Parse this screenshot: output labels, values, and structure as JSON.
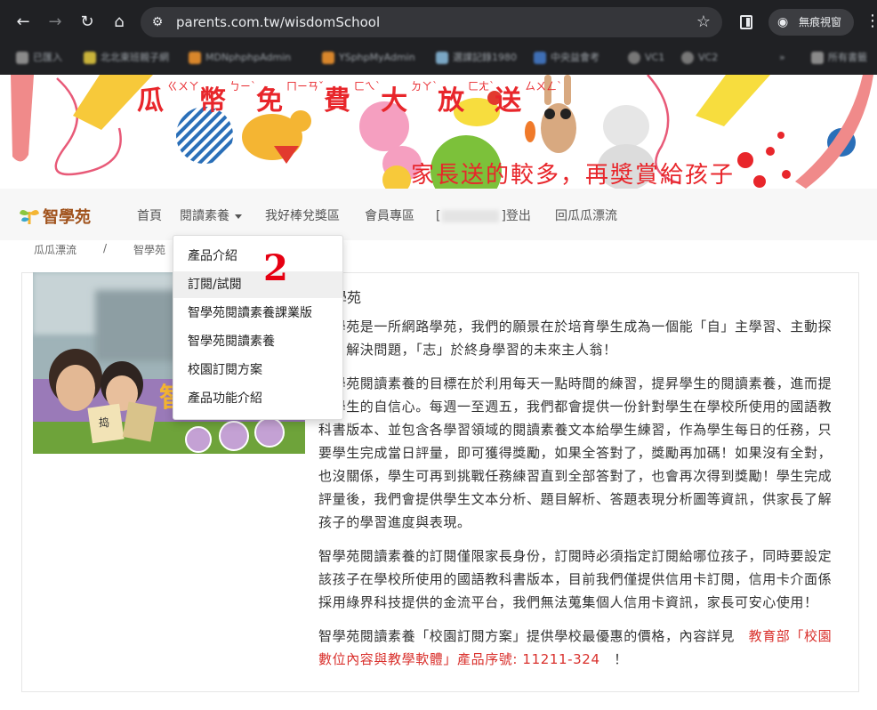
{
  "browser": {
    "url": "parents.com.tw/wisdomSchool",
    "incognito_label": "無痕視窗",
    "bookmarks": [
      "已匯入",
      "北北東班親子網",
      "MDNphphpAdmin",
      "YSphpMyAdmin",
      "選課記錄1980",
      "中央益會考",
      "VC1",
      "VC2",
      "所有書籤"
    ]
  },
  "banner": {
    "title_chars": [
      "瓜",
      "幣",
      "免",
      "費",
      "大",
      "放",
      "送"
    ],
    "title_zhuyin": [
      "ㄍㄨㄚ",
      "ㄅㄧˋ",
      "ㄇㄧㄢˇ",
      "ㄈㄟˋ",
      "ㄉㄚˋ",
      "ㄈㄤˋ",
      "ㄙㄨㄥˋ"
    ],
    "subtitle": "家長送的較多，再獎賞給孩子"
  },
  "site": {
    "logo": "智學苑",
    "nav": {
      "home": "首頁",
      "reading": "閱讀素養",
      "rewards": "我好棒兌獎區",
      "member": "會員專區",
      "bracket_open": "[",
      "logout": "]登出",
      "back": "回瓜瓜漂流"
    }
  },
  "breadcrumb": {
    "root": "瓜瓜漂流",
    "sep": "/",
    "current": "智學苑"
  },
  "dropdown": {
    "items": [
      "產品介紹",
      "訂閱/試閱",
      "智學苑閱讀素養課業版",
      "智學苑閱讀素養",
      "校園訂閱方案",
      "產品功能介紹"
    ],
    "annotation": "2"
  },
  "photo": {
    "book_text": "捣",
    "overlay_char": "智"
  },
  "main": {
    "heading": "智學苑",
    "p1": "智學苑是一所網路學苑，我們的願景在於培育學生成為一個能「自」主學習、主動探索、解決問題，「志」於終身學習的未來主人翁！",
    "p2": "智學苑閱讀素養的目標在於利用每天一點時間的練習，提昇學生的閱讀素養，進而提升學生的自信心。每週一至週五，我們都會提供一份針對學生在學校所使用的國語教科書版本、並包含各學習領域的閱讀素養文本給學生練習，作為學生每日的任務，只要學生完成當日評量，即可獲得獎勵，如果全答對了，獎勵再加碼！如果沒有全對，也沒關係，學生可再到挑戰任務練習直到全部答對了，也會再次得到獎勵！學生完成評量後，我們會提供學生文本分析、題目解析、答題表現分析圖等資訊，供家長了解孩子的學習進度與表現。",
    "p3": "智學苑閱讀素養的訂閱僅限家長身份，訂閱時必須指定訂閱給哪位孩子，同時要設定該孩子在學校所使用的國語教科書版本，目前我們僅提供信用卡訂閱，信用卡介面係採用綠界科技提供的金流平台，我們無法蒐集個人信用卡資訊，家長可安心使用！",
    "p4_lead": "智學苑閱讀素養「校園訂閱方案」提供學校最優惠的價格，內容詳見　",
    "p4_link": "教育部「校園數位內容與教學軟體」產品序號: 11211-324",
    "p4_tail": "　！"
  },
  "colors": {
    "brand": "#a0521c",
    "banner_red": "#e8262b",
    "link_red": "#d9302c",
    "chrome_dark": "#202124"
  }
}
